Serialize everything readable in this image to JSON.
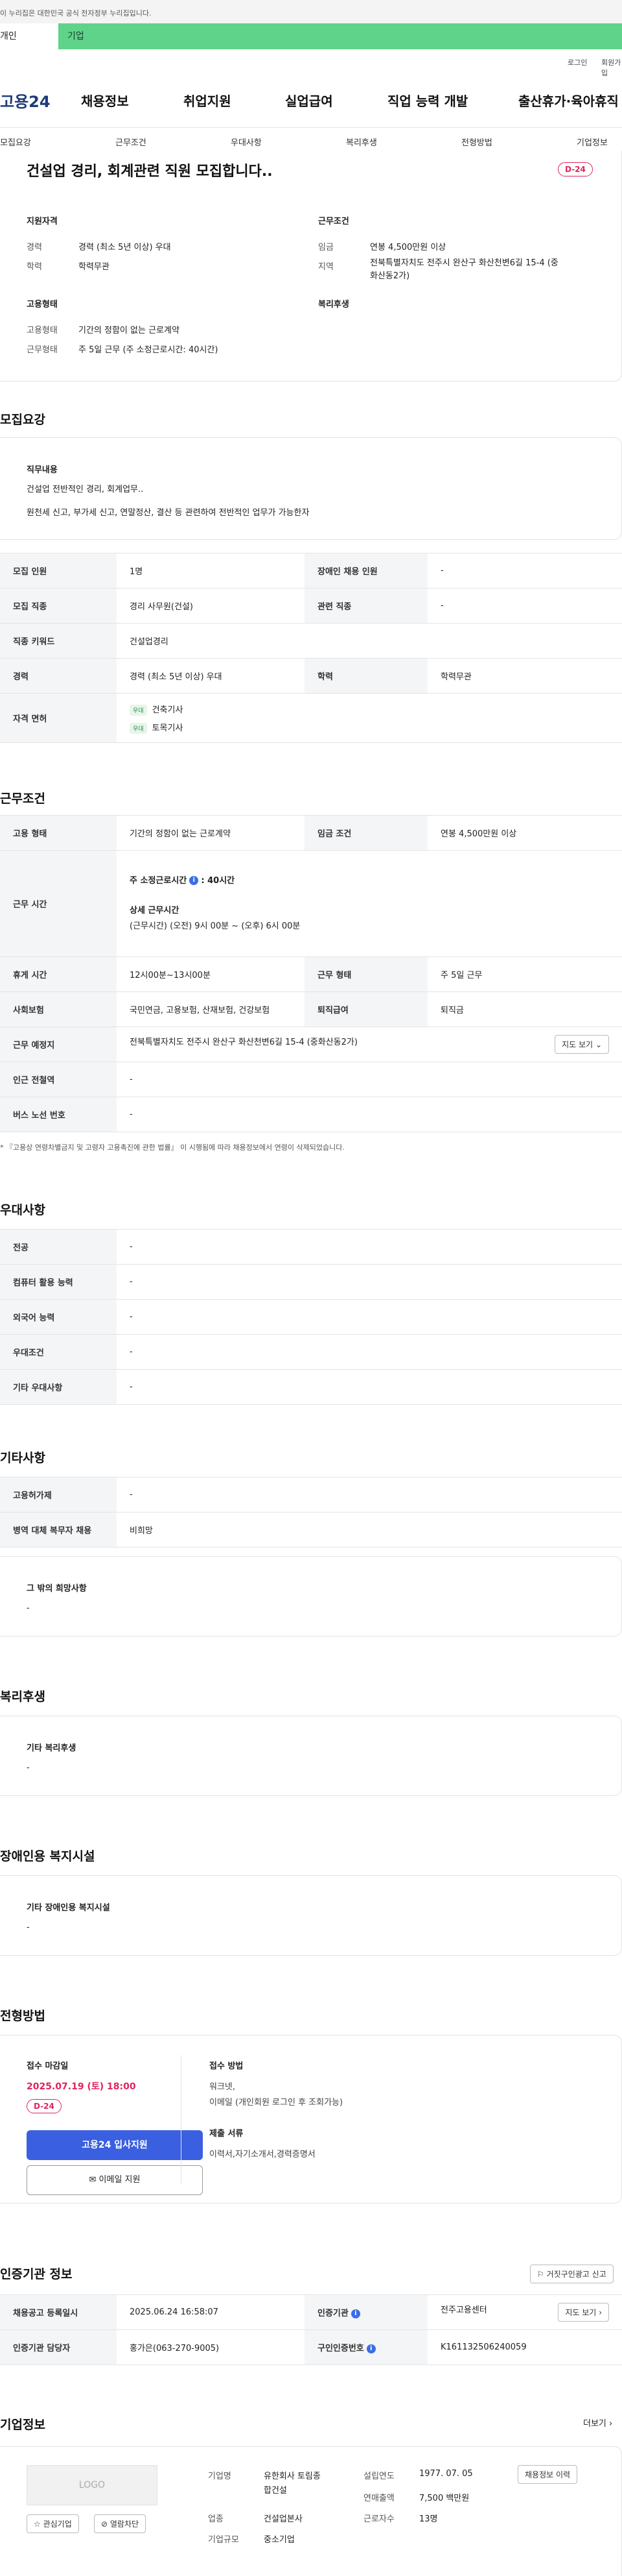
{
  "gov_banner": "이 누리집은 대한민국 공식 전자정부 누리집입니다.",
  "user_tabs": [
    "개인",
    "기업"
  ],
  "util": {
    "login": "로그인",
    "join": "회원가입"
  },
  "logo": "고용24",
  "gnb": [
    "채용정보",
    "취업지원",
    "실업급여",
    "직업 능력 개발",
    "출산휴가·육아휴직"
  ],
  "snb": [
    "모집요강",
    "근무조건",
    "우대사항",
    "복리후생",
    "전형방법",
    "기업정보"
  ],
  "summary": {
    "title": "건설업 경리, 회계관련 직원 모집합니다..",
    "dday": "D-24",
    "qual_h": "지원자격",
    "work_h": "근무조건",
    "emp_h": "고용형태",
    "welfare_h": "복리후생",
    "career_l": "경력",
    "career_v": "경력 (최소 5년 이상) 우대",
    "edu_l": "학력",
    "edu_v": "학력무관",
    "wage_l": "임금",
    "wage_v": "연봉 4,500만원 이상",
    "area_l": "지역",
    "area_v1": "전북특별자치도 전주시 완산구 화산천변6길 15-4 (중",
    "area_v2": "화산동2가)",
    "type_l": "고용형태",
    "type_v": "기간의 정함이 없는 근로계약",
    "hours_l": "근무형태",
    "hours_v": "주 5일 근무 (주 소정근로시간: 40시간)"
  },
  "recruit": {
    "heading": "모집요강",
    "duty_h": "직무내용",
    "duty_1": "건설업 전반적인 경리, 회계업무..",
    "duty_2": "원천세 신고, 부가세 신고, 연말정산, 결산 등 관련하여 전반적인 업무가 가능한자",
    "count_l": "모집 인원",
    "count_v": "1명",
    "disabled_l": "장애인 채용 인원",
    "disabled_v": "-",
    "job_l": "모집 직종",
    "job_v": "경리 사무원(건설)",
    "related_l": "관련 직종",
    "related_v": "-",
    "kw_l": "직종 키워드",
    "kw_v": "건설업경리",
    "career_l": "경력",
    "career_v": "경력 (최소 5년 이상) 우대",
    "edu_l": "학력",
    "edu_v": "학력무관",
    "license_l": "자격 면허",
    "license": [
      {
        "tag": "우대",
        "name": "건축기사"
      },
      {
        "tag": "우대",
        "name": "토목기사"
      }
    ]
  },
  "work": {
    "heading": "근무조건",
    "emp_l": "고용 형태",
    "emp_v": "기간의 정함이 없는 근로계약",
    "wage_l": "임금 조건",
    "wage_v": "연봉 4,500만원 이상",
    "time_l": "근무 시간",
    "time_1": "주 소정근로시간",
    "time_1v": ": 40시간",
    "time_2": "상세 근무시간",
    "time_3": "(근무시간) (오전) 9시 00분 ~ (오후) 6시 00분",
    "rest_l": "휴게 시간",
    "rest_v": "12시00분~13시00분",
    "form_l": "근무 형태",
    "form_v": "주 5일 근무",
    "ins_l": "사회보험",
    "ins_v": "국민연금, 고용보험, 산재보험, 건강보험",
    "sev_l": "퇴직급여",
    "sev_v": "퇴직금",
    "place_l": "근무 예정지",
    "place_v": "전북특별자치도 전주시 완산구 화산천변6길 15-4 (중화산동2가)",
    "map_btn": "지도 보기",
    "station_l": "인근 전철역",
    "station_v": "-",
    "bus_l": "버스 노선 번호",
    "bus_v": "-",
    "notice": "* 『고용상 연령차별금지 및 고령자 고용촉진에 관한 법률』 이 시행됨에 따라 채용정보에서 연령이 삭제되었습니다."
  },
  "pref": {
    "heading": "우대사항",
    "rows": [
      {
        "l": "전공",
        "v": "-"
      },
      {
        "l": "컴퓨터 활용 능력",
        "v": "-"
      },
      {
        "l": "외국어 능력",
        "v": "-"
      },
      {
        "l": "우대조건",
        "v": "-"
      },
      {
        "l": "기타 우대사항",
        "v": "-"
      }
    ]
  },
  "etc": {
    "heading": "기타사항",
    "emp_l": "고용허가제",
    "emp_v": "-",
    "mil_l": "병역 대체 복무자 채용",
    "mil_v": "비희망",
    "wish_h": "그 밖의 희망사항",
    "wish_v": "-"
  },
  "welfare": {
    "heading": "복리후생",
    "h": "기타 복리후생",
    "v": "-"
  },
  "facility": {
    "heading": "장애인용 복지시설",
    "h": "기타 장애인용 복지시설",
    "v": "-"
  },
  "process": {
    "heading": "전형방법",
    "deadline_h": "접수 마감일",
    "deadline_v": "2025.07.19 (토) 18:00",
    "dday": "D-24",
    "apply_btn": "고용24 입사지원",
    "email_btn": "이메일 지원",
    "method_h": "접수 방법",
    "method_1": "워크넷,",
    "method_2": "이메일 (개인회원 로그인 후 조회가능)",
    "docs_h": "제출 서류",
    "docs_v": "이력서,자기소개서,경력증명서"
  },
  "agency": {
    "heading": "인증기관 정보",
    "report_btn": "거짓구인광고 신고",
    "reg_l": "채용공고 등록일시",
    "reg_v": "2025.06.24 16:58:07",
    "org_l": "인증기관",
    "org_v": "전주고용센터",
    "map_btn": "지도 보기",
    "mgr_l": "인증기관 담당자",
    "mgr_v": "홍가은(063-270-9005)",
    "auth_l": "구인인증번호",
    "auth_v": "K161132506240059"
  },
  "company": {
    "heading": "기업정보",
    "more": "더보기",
    "logo": "LOGO",
    "fav_btn": "관심기업",
    "block_btn": "열람차단",
    "name_l": "기업명",
    "name_v1": "유한회사 토림종",
    "name_v2": "합건설",
    "ind_l": "업종",
    "ind_v": "건설업본사",
    "size_l": "기업규모",
    "size_v": "중소기업",
    "est_l": "설립연도",
    "est_v": "1977. 07. 05",
    "sales_l": "연매출액",
    "sales_v": "7,500 백만원",
    "emp_l": "근로자수",
    "emp_v": "13명",
    "history_btn": "채용정보 이력"
  }
}
